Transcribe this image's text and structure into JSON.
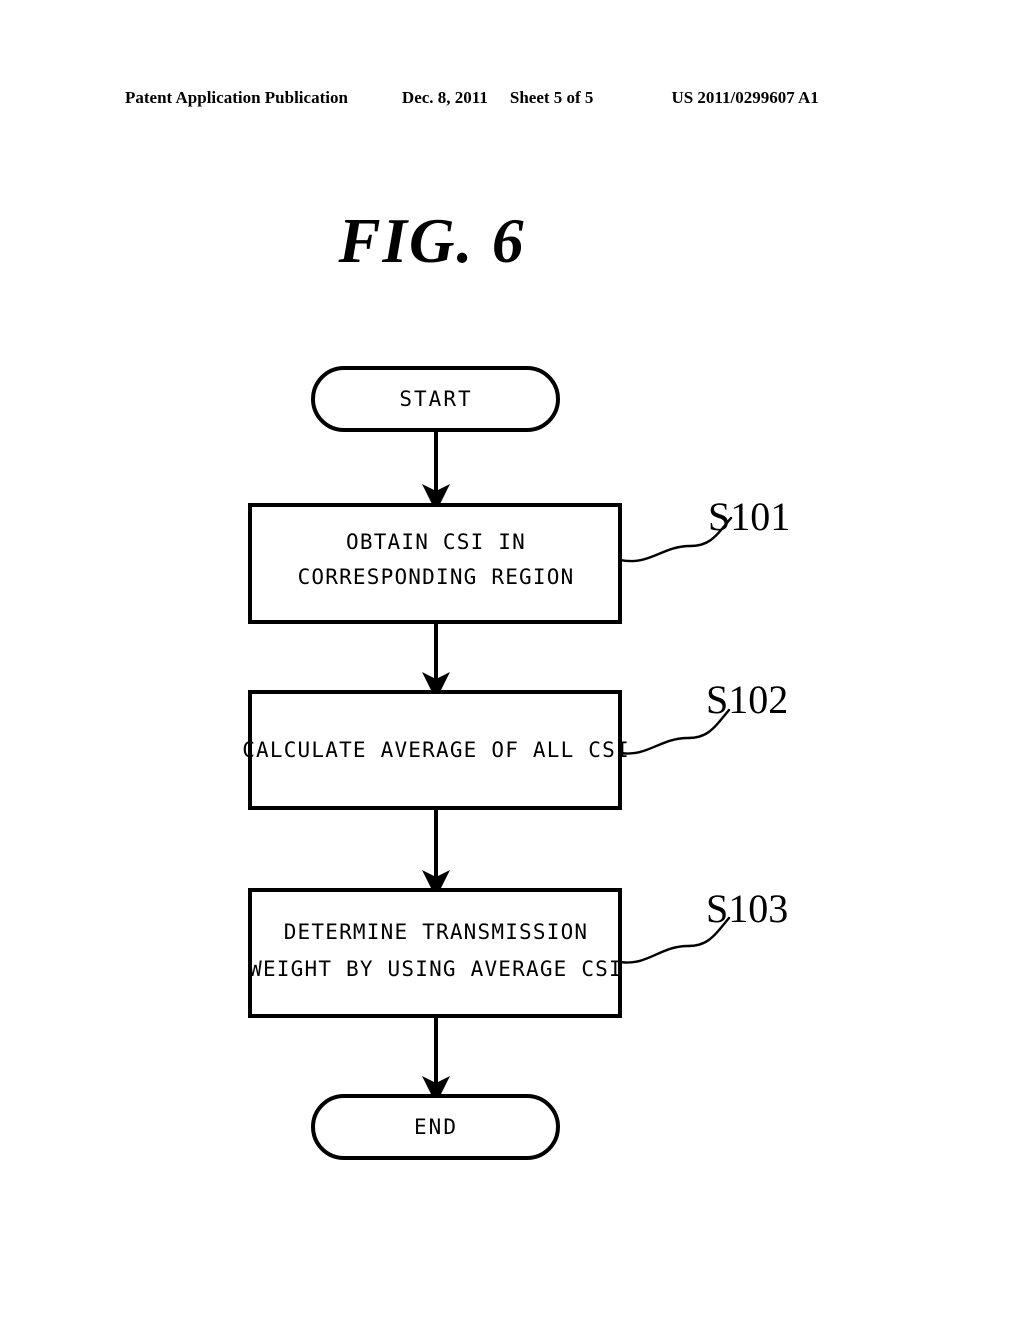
{
  "header": {
    "publication": "Patent Application Publication",
    "date": "Dec. 8, 2011",
    "sheet": "Sheet 5 of 5",
    "document_number": "US 2011/0299607 A1"
  },
  "figure": {
    "title": "FIG. 6"
  },
  "flowchart": {
    "start": {
      "label": "START"
    },
    "end": {
      "label": "END"
    },
    "steps": [
      {
        "id": "S101",
        "line1": "OBTAIN CSI IN",
        "line2": "CORRESPONDING REGION"
      },
      {
        "id": "S102",
        "line1": "CALCULATE AVERAGE OF ALL CSI",
        "line2": ""
      },
      {
        "id": "S103",
        "line1": "DETERMINE TRANSMISSION",
        "line2": "WEIGHT BY USING AVERAGE CSI"
      }
    ]
  },
  "colors": {
    "ink": "#000000",
    "paper": "#ffffff"
  }
}
